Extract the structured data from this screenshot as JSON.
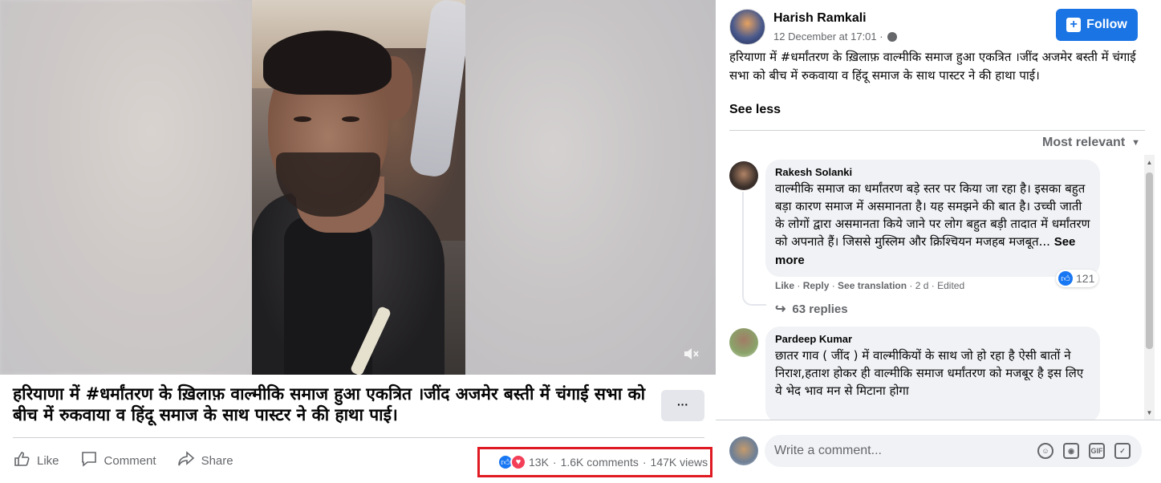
{
  "post": {
    "caption": "हरियाणा में #धर्मांतरण के ख़िलाफ़ वाल्मीकि समाज हुआ एकत्रित ।जींद अजमेर बस्ती में चंगाई सभा को बीच में रुकवाया व हिंदू समाज के साथ पास्टर ने की हाथा पाई।",
    "more_label": "···",
    "actions": {
      "like": "Like",
      "comment": "Comment",
      "share": "Share"
    },
    "stats": {
      "reactions": "13K",
      "comments": "1.6K comments",
      "views": "147K views",
      "separator": "·"
    }
  },
  "sidebar": {
    "author": "Harish Ramkali",
    "date": "12 December at 17:01 ·",
    "follow_label": "Follow",
    "text": "हरियाणा में #धर्मांतरण के ख़िलाफ़ वाल्मीकि समाज हुआ एकत्रित ।जींद अजमेर बस्ती में चंगाई सभा को बीच में रुकवाया व हिंदू समाज के साथ पास्टर ने की हाथा पाई।",
    "see_less": "See less",
    "sort_label": "Most relevant",
    "comments": [
      {
        "name": "Rakesh Solanki",
        "text": "वाल्मीकि समाज का धर्मांतरण बड़े स्तर पर किया जा रहा है। इसका बहुत बड़ा कारण समाज में असमानता है। यह समझने की बात है। उच्ची जाती के लोगों द्वारा असमानता किये जाने पर लोग बहुत बड़ी तादात में धर्मांतरण को अपनाते हैं। जिससे मुस्लिम और क्रिश्चियन मजहब मजबूत...",
        "see_more": "See more",
        "reactions": "121",
        "meta": {
          "like": "Like",
          "reply": "Reply",
          "translate": "See translation",
          "time": "2 d",
          "edited": "Edited"
        },
        "replies": "63 replies"
      },
      {
        "name": "Pardeep Kumar",
        "text": "छातर गाव ( जींद ) में वाल्मीकियों के साथ जो हो रहा है ऐसी बातों ने निराश,हताश होकर ही वाल्मीकि समाज धर्मांतरण को मजबूर है इस लिए ये भेद भाव मन से मिटाना होगा"
      }
    ],
    "write_placeholder": "Write a comment...",
    "write_icons": [
      "emoji-icon",
      "camera-icon",
      "gif-icon",
      "sticker-icon"
    ]
  },
  "colors": {
    "accent": "#1b74e4",
    "highlight_box": "#e01a22",
    "like": "#1877f2",
    "love": "#f33e58"
  }
}
